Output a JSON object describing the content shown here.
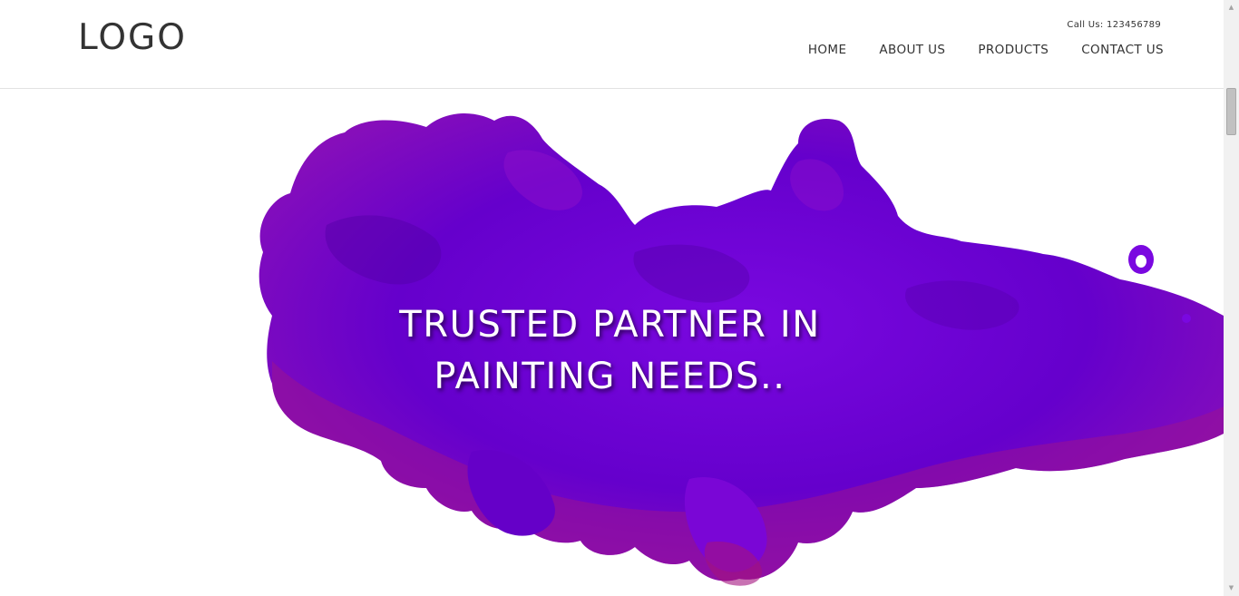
{
  "header": {
    "logo": "LOGO",
    "call": "Call Us: 123456789",
    "nav": [
      {
        "label": "HOME"
      },
      {
        "label": "ABOUT US"
      },
      {
        "label": "PRODUCTS"
      },
      {
        "label": "CONTACT US"
      }
    ]
  },
  "hero": {
    "line1": "TRUSTED PARTNER IN",
    "line2": "PAINTING NEEDS..",
    "colors": {
      "ink_primary": "#6c00d2",
      "ink_magenta": "#a3127f",
      "ink_dark": "#4a0090"
    }
  },
  "scrollbar": {
    "up_icon": "arrow-up-icon",
    "down_icon": "arrow-down-icon"
  }
}
